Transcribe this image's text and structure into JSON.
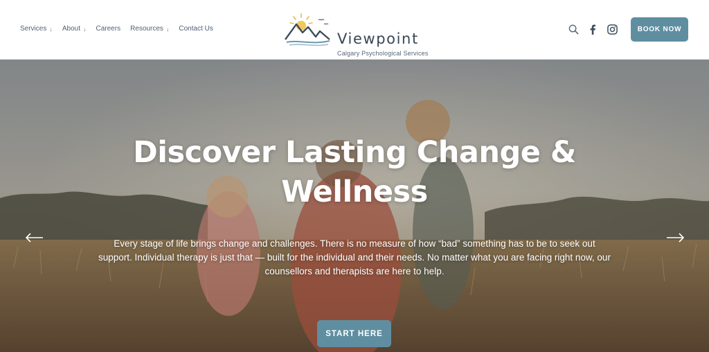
{
  "header": {
    "nav": [
      {
        "label": "Services",
        "dropdown": true
      },
      {
        "label": "About",
        "dropdown": true
      },
      {
        "label": "Careers",
        "dropdown": false
      },
      {
        "label": "Resources",
        "dropdown": true
      },
      {
        "label": "Contact Us",
        "dropdown": false
      }
    ],
    "logo": {
      "title": "Viewpoint",
      "subtitle": "Calgary Psychological Services"
    },
    "icons": [
      "search-icon",
      "facebook-icon",
      "instagram-icon"
    ],
    "book_label": "BOOK NOW"
  },
  "hero": {
    "title": "Discover Lasting Change & Wellness",
    "text": "Every stage of life brings change and challenges. There is no measure of how “bad” something has to be to seek out support. Individual therapy is just that — built for the individual and their needs. No matter what you are facing right now, our counsellors and therapists are here to help.",
    "cta_label": "START HERE",
    "prev_arrow": "←",
    "next_arrow": "→"
  },
  "colors": {
    "accent": "#5f8ea1",
    "text_dark": "#3a4656",
    "hero_text": "#ffffff"
  }
}
